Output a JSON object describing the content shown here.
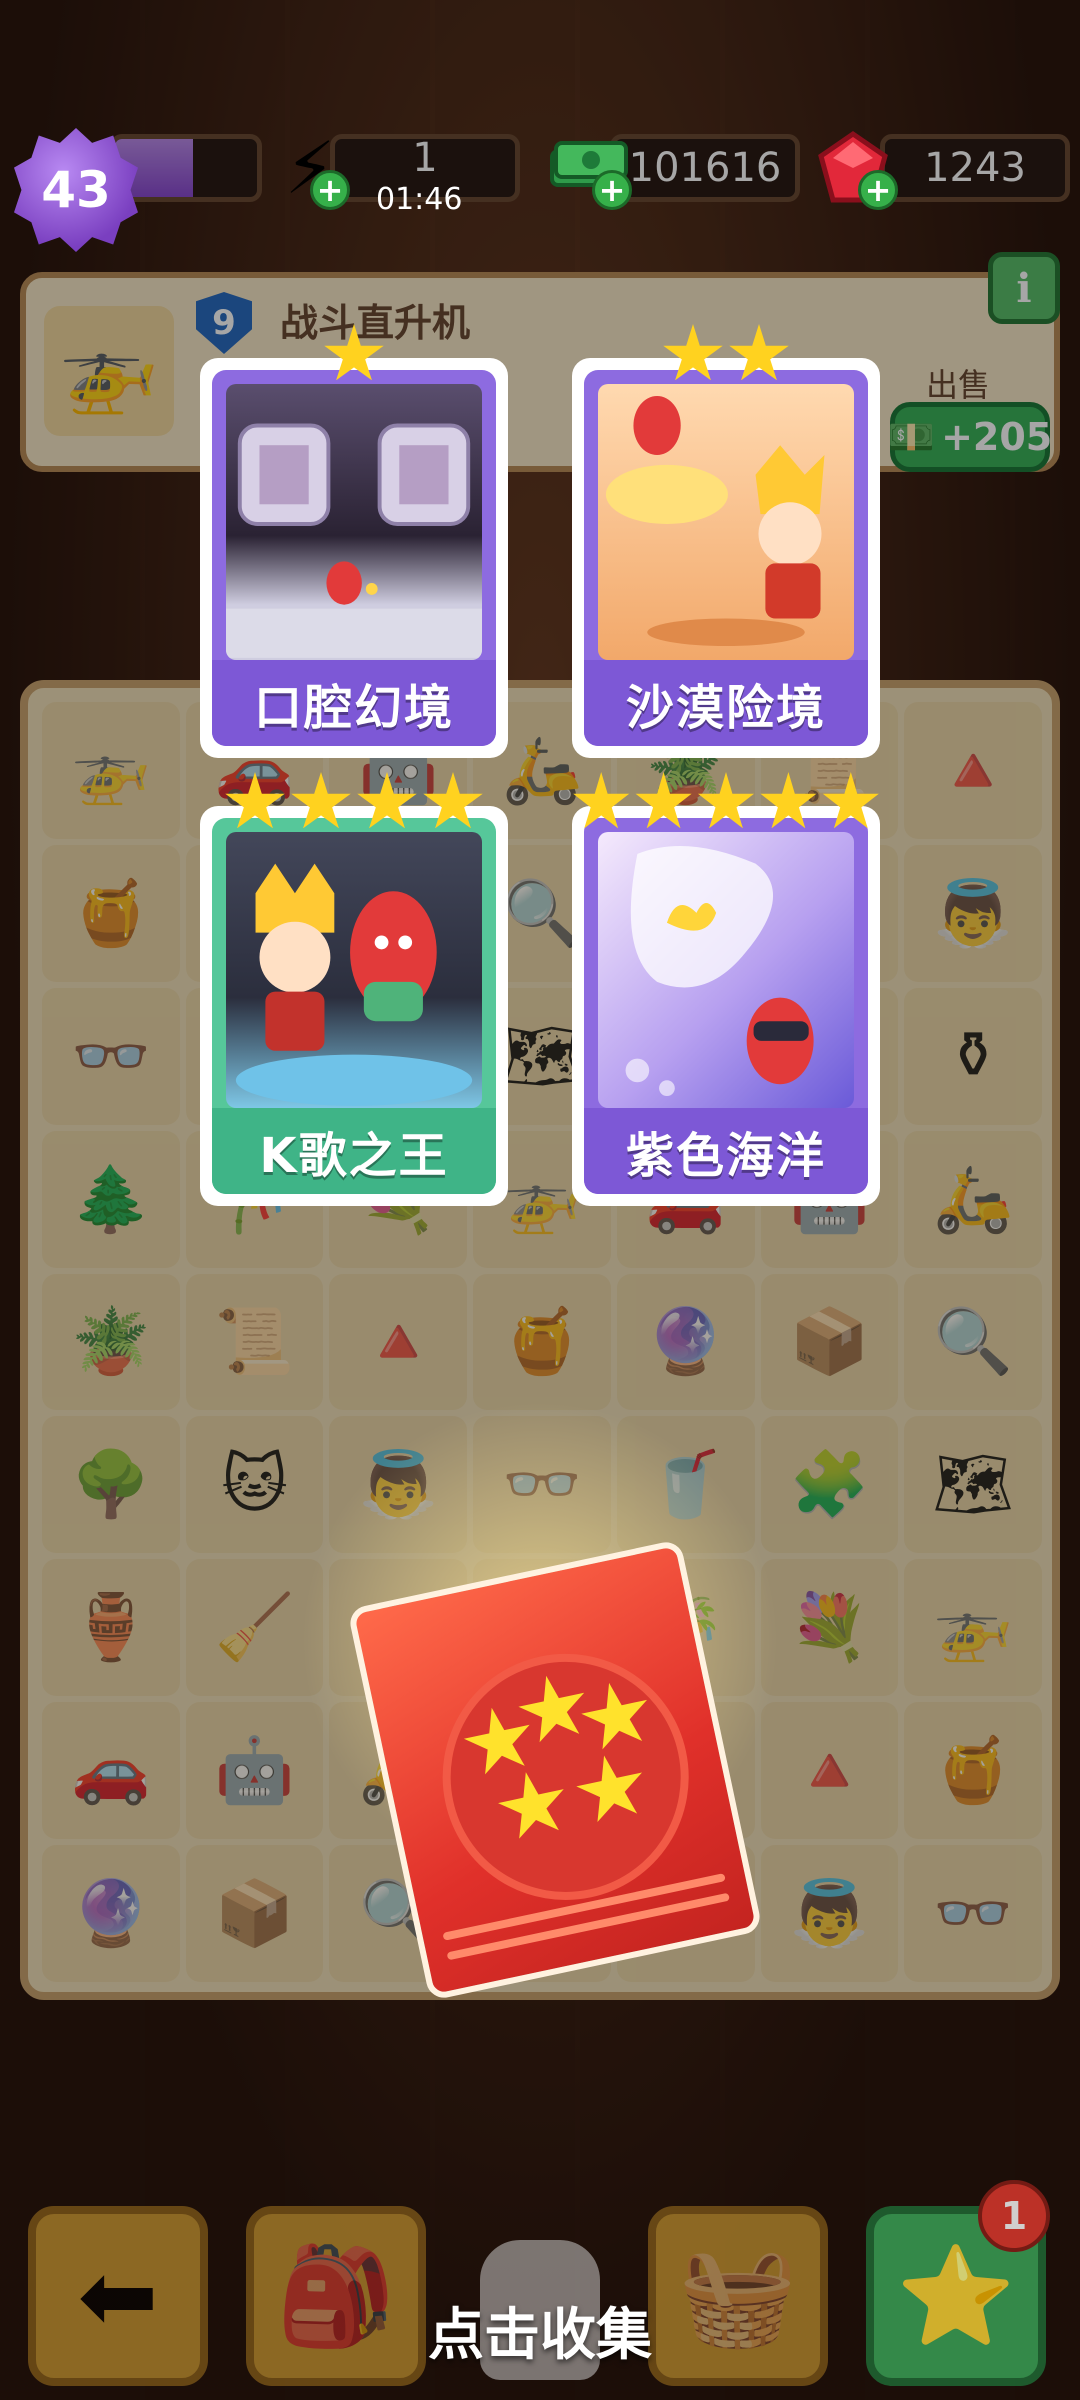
{
  "hud": {
    "level": "43",
    "xp_progress": 0.55,
    "energy": "1",
    "energy_timer": "01:46",
    "cash": "101616",
    "gems": "1243"
  },
  "info_panel": {
    "item_level": "9",
    "item_name": "战斗直升机",
    "info_icon": "i",
    "sell_label": "出售",
    "sell_value": "+205"
  },
  "cards": [
    {
      "title": "口腔幻境",
      "stars": 1,
      "theme": "purple"
    },
    {
      "title": "沙漠险境",
      "stars": 2,
      "theme": "purple"
    },
    {
      "title": "K歌之王",
      "stars": 4,
      "theme": "green"
    },
    {
      "title": "紫色海洋",
      "stars": 5,
      "theme": "purple"
    }
  ],
  "pack": {
    "stars": 5
  },
  "prompt": "点击收集",
  "bottom_bar": {
    "album_badge": "1"
  },
  "board_icons": [
    "helicopter-icon",
    "car-icon",
    "robot-icon",
    "scooter-icon",
    "plant-icon",
    "note-icon",
    "cone-icon",
    "jar-icon",
    "orb-icon",
    "box-icon",
    "magnifier-icon",
    "bush-icon",
    "cat-icon",
    "angel-icon",
    "glasses-icon",
    "juice-icon",
    "puzzle-icon",
    "map-icon",
    "pot-icon",
    "rake-icon",
    "vase-icon",
    "tree-icon",
    "bonsai-icon",
    "flowers-icon"
  ],
  "colors": {
    "card_purple": "#7d58d6",
    "card_green": "#3fb487",
    "pack_red": "#e0302a",
    "star_yellow": "#ffd21f"
  }
}
